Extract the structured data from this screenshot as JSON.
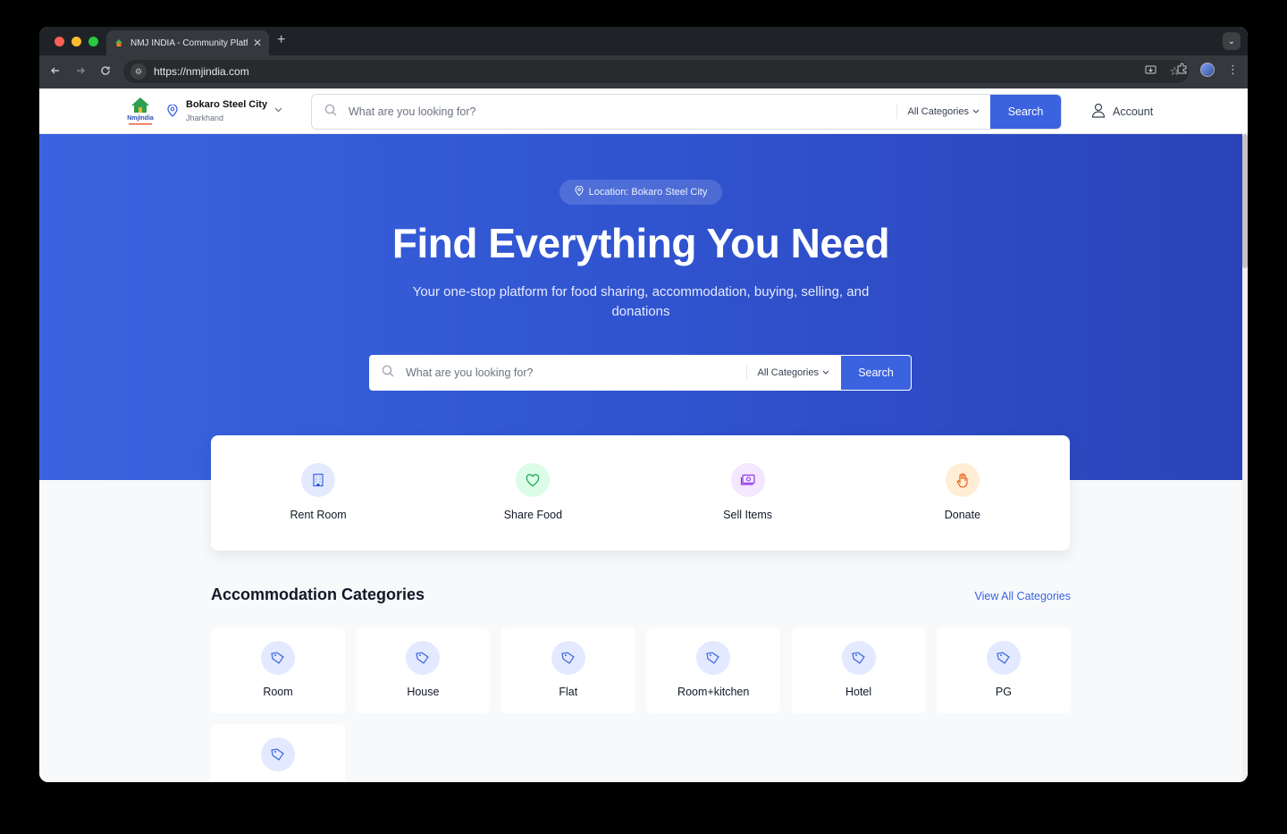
{
  "browser": {
    "tab_title": "NMJ INDIA - Community Platf",
    "url": "https://nmjindia.com"
  },
  "header": {
    "city": "Bokaro Steel City",
    "state": "Jharkhand",
    "search_placeholder": "What are you looking for?",
    "category": "All Categories",
    "search_label": "Search",
    "account_label": "Account"
  },
  "hero": {
    "location_pill": "Location: Bokaro Steel City",
    "headline": "Find Everything You Need",
    "subline": "Your one-stop platform for food sharing, accommodation, buying, selling, and donations",
    "search_placeholder": "What are you looking for?",
    "category": "All Categories",
    "search_label": "Search"
  },
  "actions": [
    {
      "label": "Rent Room",
      "icon": "building-icon",
      "bg": "#e3eaff",
      "color": "#3b63e0"
    },
    {
      "label": "Share Food",
      "icon": "heart-icon",
      "bg": "#dcfce7",
      "color": "#16a34a"
    },
    {
      "label": "Sell Items",
      "icon": "money-icon",
      "bg": "#f3e8ff",
      "color": "#9333ea"
    },
    {
      "label": "Donate",
      "icon": "hand-icon",
      "bg": "#ffedd5",
      "color": "#ea580c"
    }
  ],
  "accommodation": {
    "title": "Accommodation Categories",
    "view_all": "View All Categories",
    "items": [
      {
        "label": "Room"
      },
      {
        "label": "House"
      },
      {
        "label": "Flat"
      },
      {
        "label": "Room+kitchen"
      },
      {
        "label": "Hotel"
      },
      {
        "label": "PG"
      },
      {
        "label": ""
      }
    ]
  },
  "colors": {
    "primary": "#3b63e0"
  }
}
